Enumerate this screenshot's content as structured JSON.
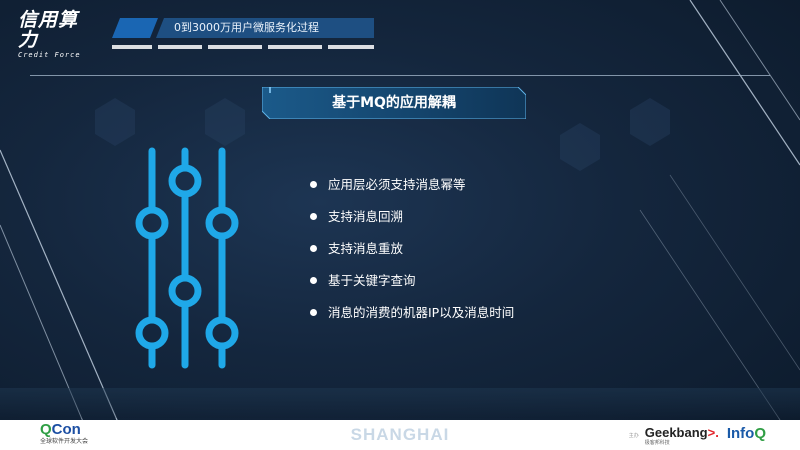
{
  "logo": {
    "main": "信用算力",
    "sub": "Credit Force"
  },
  "header": {
    "subtitle": "0到3000万用户微服务化过程"
  },
  "slide": {
    "title": "基于MQ的应用解耦",
    "bullets": [
      "应用层必须支持消息幂等",
      "支持消息回溯",
      "支持消息重放",
      "基于关键字查询",
      "消息的消费的机器IP以及消息时间"
    ]
  },
  "footer": {
    "qcon_name_q": "Q",
    "qcon_name_rest": "Con",
    "qcon_sub": "全球软件开发大会",
    "city": "SHANGHAI",
    "org_mark": "主办",
    "geek_name": "Geekbang",
    "geek_x": ">.",
    "geek_sub": "极客邦科技",
    "infoq_main": "Info",
    "infoq_q": "Q"
  },
  "colors": {
    "accent": "#1fa8e8",
    "background": "#14263d",
    "text": "#ffffff"
  },
  "icons": [
    "slider-controls-icon",
    "bullet-dot-icon"
  ]
}
